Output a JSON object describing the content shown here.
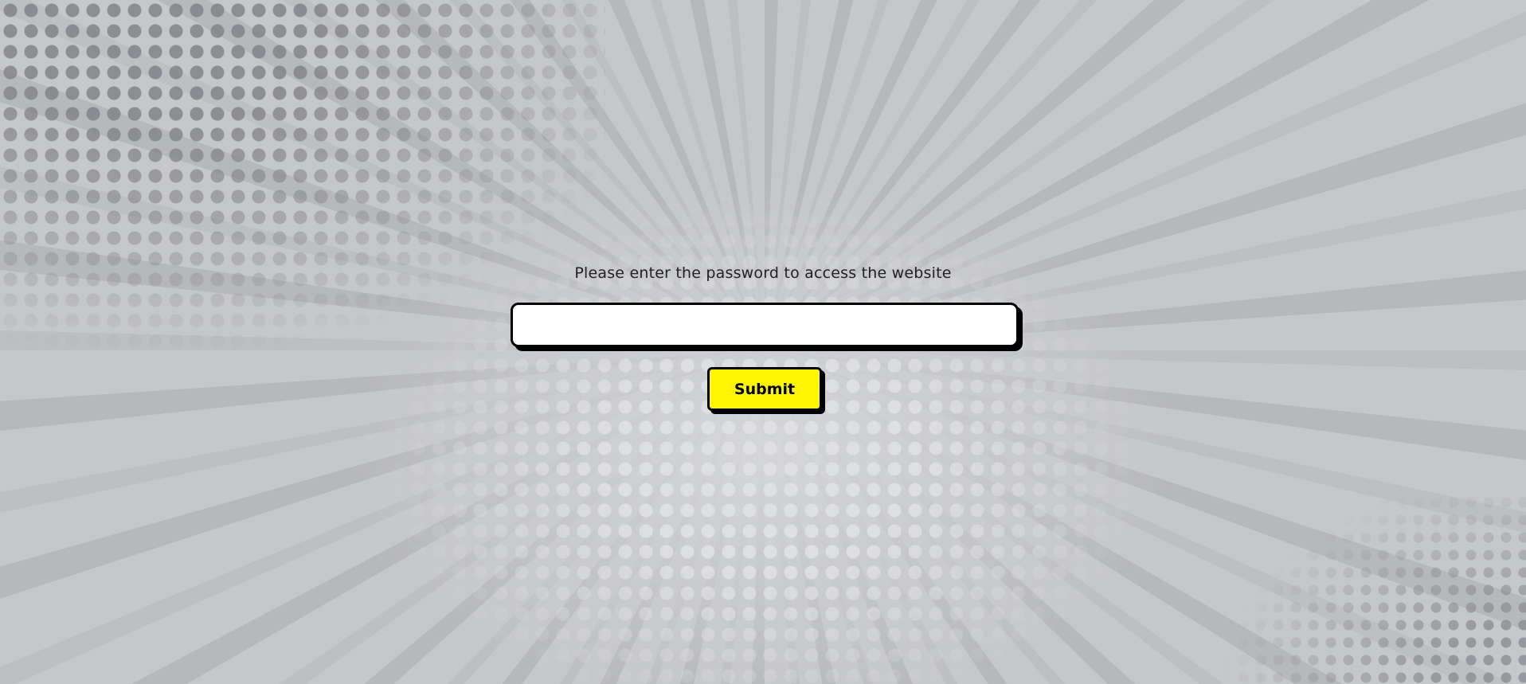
{
  "login": {
    "prompt": "Please enter the password to access the website",
    "password_value": "",
    "submit_label": "Submit"
  },
  "colors": {
    "background": "#c6c7ca",
    "button": "#fff500",
    "border": "#000000"
  }
}
